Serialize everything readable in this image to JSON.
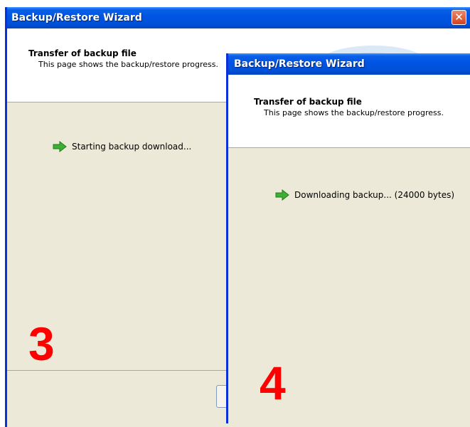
{
  "window3": {
    "title": "Backup/Restore Wizard",
    "close_glyph": "✕",
    "header_title": "Transfer of backup file",
    "header_subtitle": "This page shows the backup/restore progress.",
    "status_icon": "green-arrow-icon",
    "status_text": "Starting backup download...",
    "step_number": "3"
  },
  "window4": {
    "title": "Backup/Restore Wizard",
    "header_title": "Transfer of backup file",
    "header_subtitle": "This page shows the backup/restore progress.",
    "status_icon": "green-arrow-icon",
    "status_text": "Downloading backup... (24000 bytes)",
    "step_number": "4"
  },
  "colors": {
    "titlebar_blue": "#0054e3",
    "window_body": "#ece9d8",
    "step_number_red": "#ff0000",
    "arrow_green": "#3cb034"
  }
}
